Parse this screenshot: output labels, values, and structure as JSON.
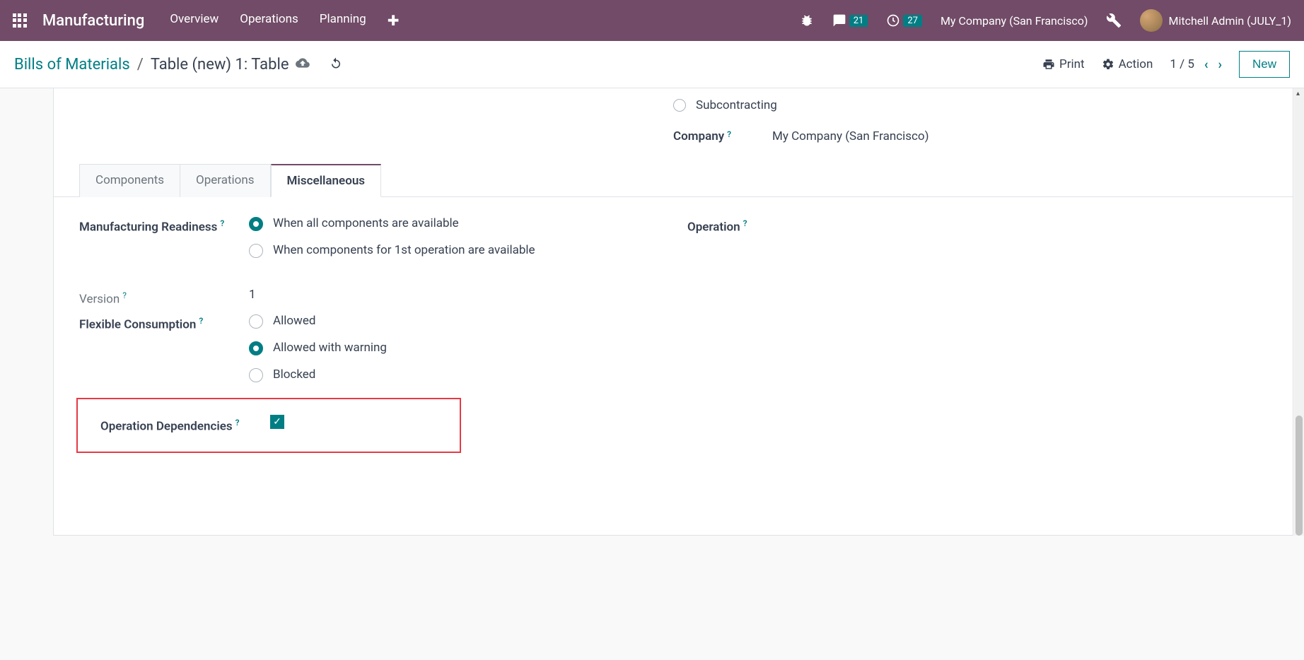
{
  "navbar": {
    "brand": "Manufacturing",
    "menu": [
      "Overview",
      "Operations",
      "Planning"
    ],
    "msg_count": "21",
    "activity_count": "27",
    "company": "My Company (San Francisco)",
    "user": "Mitchell Admin (JULY_1)"
  },
  "subheader": {
    "root": "Bills of Materials",
    "sep": "/",
    "current": "Table (new) 1: Table",
    "print": "Print",
    "action": "Action",
    "pager": "1 / 5",
    "new_btn": "New"
  },
  "top": {
    "subcontracting_option": "Subcontracting",
    "company_label": "Company",
    "company_value": "My Company (San Francisco)"
  },
  "tabs": [
    "Components",
    "Operations",
    "Miscellaneous"
  ],
  "form": {
    "readiness_label": "Manufacturing Readiness",
    "readiness_opt1": "When all components are available",
    "readiness_opt2": "When components for 1st operation are available",
    "version_label": "Version",
    "version_value": "1",
    "flex_label": "Flexible Consumption",
    "flex_opt1": "Allowed",
    "flex_opt2": "Allowed with warning",
    "flex_opt3": "Blocked",
    "opdep_label": "Operation Dependencies",
    "operation_label": "Operation",
    "help": "?"
  }
}
